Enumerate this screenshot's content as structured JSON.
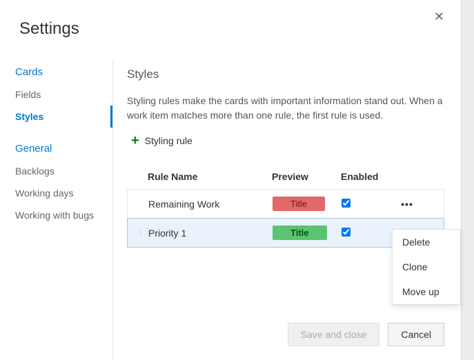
{
  "dialog": {
    "title": "Settings",
    "close_glyph": "✕"
  },
  "sidebar": {
    "groups": [
      {
        "title": "Cards",
        "items": [
          {
            "label": "Fields",
            "active": false
          },
          {
            "label": "Styles",
            "active": true
          }
        ]
      },
      {
        "title": "General",
        "items": [
          {
            "label": "Backlogs",
            "active": false
          },
          {
            "label": "Working days",
            "active": false
          },
          {
            "label": "Working with bugs",
            "active": false
          }
        ]
      }
    ]
  },
  "main": {
    "section_title": "Styles",
    "description": "Styling rules make the cards with important information stand out. When a work item matches more than one rule, the first rule is used.",
    "add_label": "Styling rule",
    "columns": {
      "name": "Rule Name",
      "preview": "Preview",
      "enabled": "Enabled"
    },
    "rules": [
      {
        "name": "Remaining Work",
        "preview_text": "Title",
        "preview_style": "red",
        "enabled": true,
        "selected": false
      },
      {
        "name": "Priority 1",
        "preview_text": "Title",
        "preview_style": "green",
        "enabled": true,
        "selected": true
      }
    ]
  },
  "context_menu": {
    "items": [
      {
        "label": "Delete"
      },
      {
        "label": "Clone"
      },
      {
        "label": "Move up"
      }
    ]
  },
  "footer": {
    "save_label": "Save and close",
    "cancel_label": "Cancel"
  }
}
